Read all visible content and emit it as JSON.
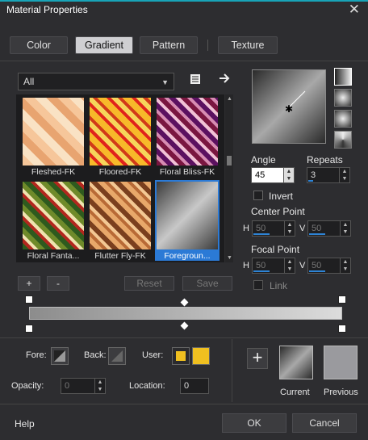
{
  "window": {
    "title": "Material Properties"
  },
  "tabs": [
    {
      "label": "Color",
      "active": false
    },
    {
      "label": "Gradient",
      "active": true
    },
    {
      "label": "Pattern",
      "active": false
    },
    {
      "label": "Texture",
      "active": false
    }
  ],
  "filter": {
    "selected": "All"
  },
  "gradients": [
    {
      "label": "Fleshed-FK",
      "selected": false
    },
    {
      "label": "Floored-FK",
      "selected": false
    },
    {
      "label": "Floral Bliss-FK",
      "selected": false
    },
    {
      "label": "Floral Fanta...",
      "selected": false
    },
    {
      "label": "Flutter Fly-FK",
      "selected": false
    },
    {
      "label": "Foregroun...",
      "selected": true
    }
  ],
  "list_buttons": {
    "add": "+",
    "remove": "-",
    "reset": "Reset",
    "save": "Save"
  },
  "angle": {
    "label": "Angle",
    "value": "45"
  },
  "repeats": {
    "label": "Repeats",
    "value": "3"
  },
  "invert": {
    "label": "Invert",
    "checked": false
  },
  "center_point": {
    "label": "Center Point",
    "h_label": "H",
    "h": "50",
    "v_label": "V",
    "v": "50"
  },
  "focal_point": {
    "label": "Focal Point",
    "h_label": "H",
    "h": "50",
    "v_label": "V",
    "v": "50"
  },
  "link": {
    "label": "Link",
    "checked": false
  },
  "bottom": {
    "fore_label": "Fore:",
    "back_label": "Back:",
    "user_label": "User:",
    "user_color": "#f0c020",
    "opacity_label": "Opacity:",
    "opacity": "0",
    "location_label": "Location:",
    "location": "0",
    "current_label": "Current",
    "previous_label": "Previous"
  },
  "footer": {
    "help": "Help",
    "ok": "OK",
    "cancel": "Cancel"
  }
}
